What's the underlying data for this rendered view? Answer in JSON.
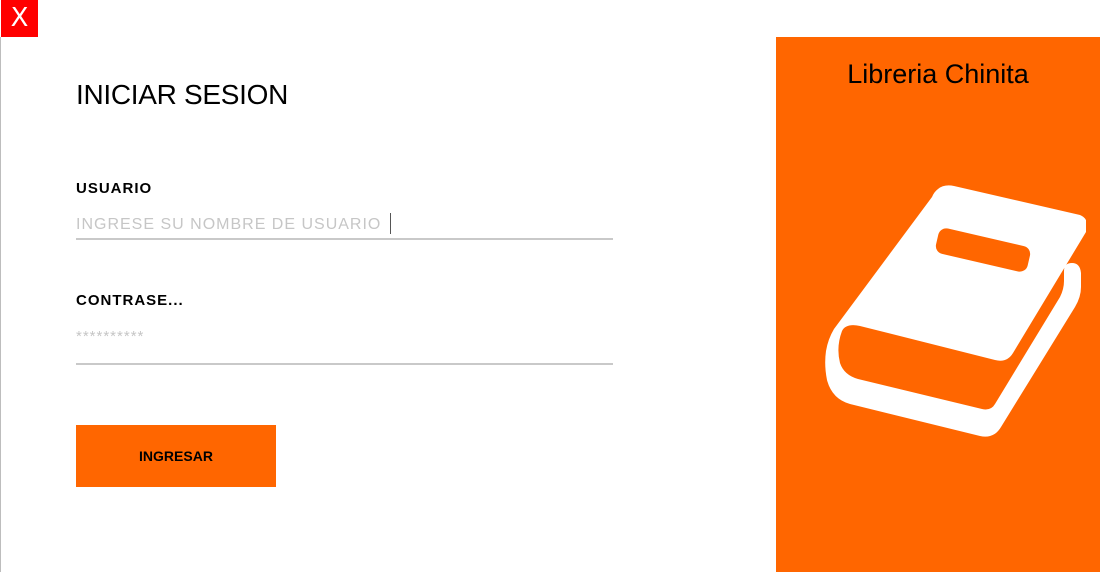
{
  "window": {
    "close_label": "X",
    "close_color": "#ff0000"
  },
  "login": {
    "title": "INICIAR SESION",
    "username_label": "USUARIO",
    "username_placeholder": "INGRESE SU NOMBRE DE USUARIO",
    "username_value": "",
    "password_label": "CONTRASE...",
    "password_placeholder": "**********",
    "password_value": "",
    "submit_label": "INGRESAR"
  },
  "brand": {
    "name": "Libreria Chinita",
    "icon": "book-icon",
    "accent_color": "#ff6600"
  }
}
